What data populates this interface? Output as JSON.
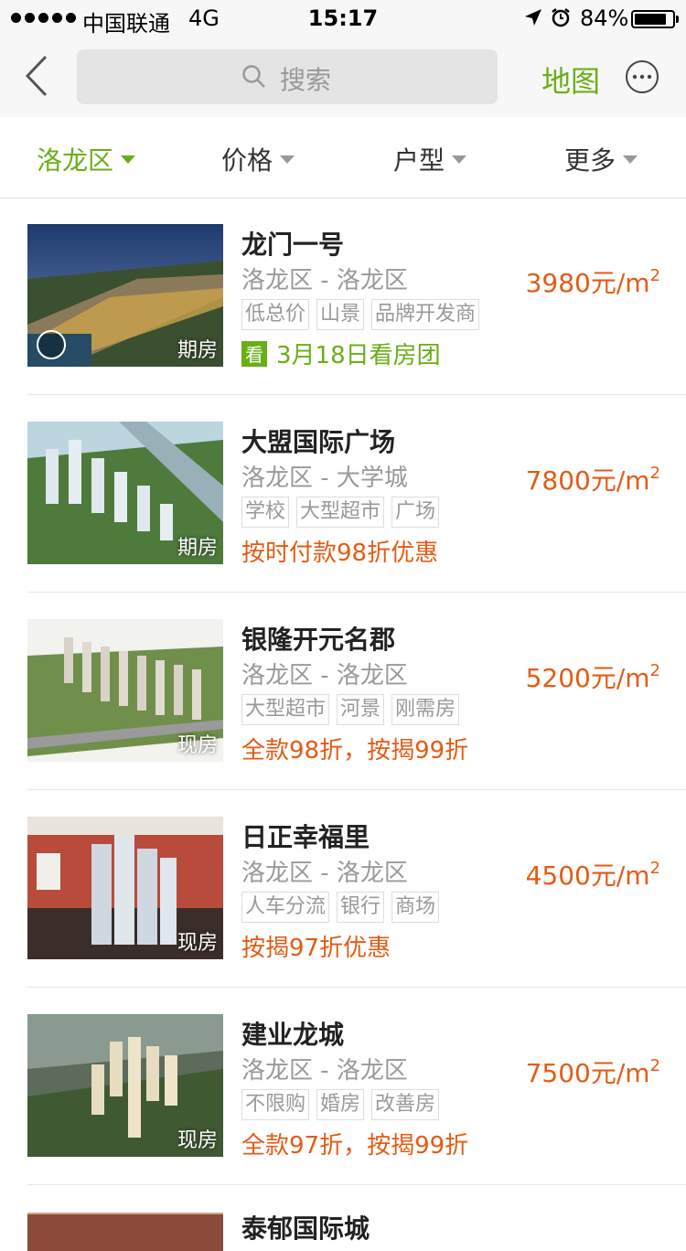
{
  "status_bar": {
    "carrier": "中国联通",
    "network": "4G",
    "time": "15:17",
    "battery_percent": "84%",
    "battery_level": 0.84
  },
  "nav": {
    "search_placeholder": "搜索",
    "map_label": "地图"
  },
  "filters": [
    {
      "label": "洛龙区",
      "active": true
    },
    {
      "label": "价格",
      "active": false
    },
    {
      "label": "户型",
      "active": false
    },
    {
      "label": "更多",
      "active": false
    }
  ],
  "listings": [
    {
      "name": "龙门一号",
      "location": "洛龙区 - 洛龙区",
      "price": "3980元/m",
      "price_sup": "2",
      "tags": [
        "低总价",
        "山景",
        "品牌开发商"
      ],
      "promo": "3月18日看房团",
      "promo_badge": "看",
      "state": "期房"
    },
    {
      "name": "大盟国际广场",
      "location": "洛龙区 - 大学城",
      "price": "7800元/m",
      "price_sup": "2",
      "tags": [
        "学校",
        "大型超市",
        "广场"
      ],
      "promo": "按时付款98折优惠",
      "state": "期房"
    },
    {
      "name": "银隆开元名郡",
      "location": "洛龙区 - 洛龙区",
      "price": "5200元/m",
      "price_sup": "2",
      "tags": [
        "大型超市",
        "河景",
        "刚需房"
      ],
      "promo": "全款98折，按揭99折",
      "state": "现房"
    },
    {
      "name": "日正幸福里",
      "location": "洛龙区 - 洛龙区",
      "price": "4500元/m",
      "price_sup": "2",
      "tags": [
        "人车分流",
        "银行",
        "商场"
      ],
      "promo": "按揭97折优惠",
      "state": "现房"
    },
    {
      "name": "建业龙城",
      "location": "洛龙区 - 洛龙区",
      "price": "7500元/m",
      "price_sup": "2",
      "tags": [
        "不限购",
        "婚房",
        "改善房"
      ],
      "promo": "全款97折，按揭99折",
      "state": "现房"
    }
  ],
  "partial_listing": {
    "name": "泰郁国际城"
  },
  "colors": {
    "accent_green": "#6aae16",
    "price_orange": "#e55b14"
  }
}
